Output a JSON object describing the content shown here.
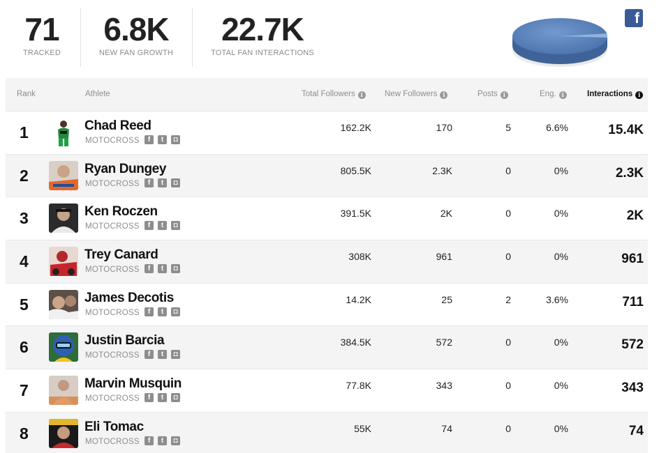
{
  "stats": [
    {
      "value": "71",
      "label": "TRACKED"
    },
    {
      "value": "6.8K",
      "label": "NEW FAN GROWTH"
    },
    {
      "value": "22.7K",
      "label": "TOTAL FAN INTERACTIONS"
    }
  ],
  "network_icon": "facebook-icon",
  "colors": {
    "facebook": "#3b5b98",
    "pie": "#5b84bf",
    "muted": "#8d8d8d"
  },
  "table": {
    "headers": {
      "rank": "Rank",
      "athlete": "Athlete",
      "total_followers": "Total Followers",
      "new_followers": "New Followers",
      "posts": "Posts",
      "eng": "Eng.",
      "interactions": "Interactions"
    },
    "rows": [
      {
        "rank": "1",
        "name": "Chad Reed",
        "sport": "MOTOCROSS",
        "total": "162.2K",
        "new": "170",
        "posts": "5",
        "eng": "6.6%",
        "interactions": "15.4K"
      },
      {
        "rank": "2",
        "name": "Ryan Dungey",
        "sport": "MOTOCROSS",
        "total": "805.5K",
        "new": "2.3K",
        "posts": "0",
        "eng": "0%",
        "interactions": "2.3K"
      },
      {
        "rank": "3",
        "name": "Ken Roczen",
        "sport": "MOTOCROSS",
        "total": "391.5K",
        "new": "2K",
        "posts": "0",
        "eng": "0%",
        "interactions": "2K"
      },
      {
        "rank": "4",
        "name": "Trey Canard",
        "sport": "MOTOCROSS",
        "total": "308K",
        "new": "961",
        "posts": "0",
        "eng": "0%",
        "interactions": "961"
      },
      {
        "rank": "5",
        "name": "James Decotis",
        "sport": "MOTOCROSS",
        "total": "14.2K",
        "new": "25",
        "posts": "2",
        "eng": "3.6%",
        "interactions": "711"
      },
      {
        "rank": "6",
        "name": "Justin Barcia",
        "sport": "MOTOCROSS",
        "total": "384.5K",
        "new": "572",
        "posts": "0",
        "eng": "0%",
        "interactions": "572"
      },
      {
        "rank": "7",
        "name": "Marvin Musquin",
        "sport": "MOTOCROSS",
        "total": "77.8K",
        "new": "343",
        "posts": "0",
        "eng": "0%",
        "interactions": "343"
      },
      {
        "rank": "8",
        "name": "Eli Tomac",
        "sport": "MOTOCROSS",
        "total": "55K",
        "new": "74",
        "posts": "0",
        "eng": "0%",
        "interactions": "74"
      }
    ]
  }
}
